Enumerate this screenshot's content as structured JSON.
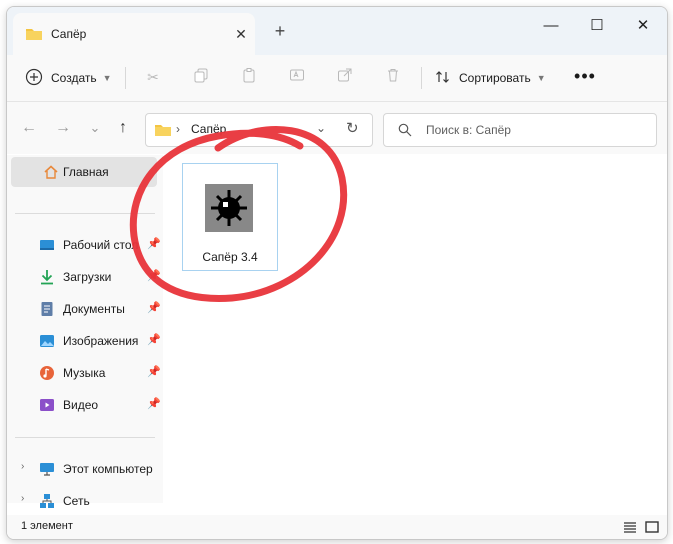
{
  "window": {
    "tab_title": "Сапёр",
    "tab_close": "✕",
    "new_tab": "+",
    "minimize": "—",
    "maximize": "☐",
    "close": "✕"
  },
  "toolbar": {
    "create_label": "Создать",
    "sort_label": "Сортировать",
    "more": "•••",
    "icons": [
      "cut-icon",
      "copy-icon",
      "paste-icon",
      "rename-icon",
      "share-icon",
      "delete-icon"
    ]
  },
  "nav": {
    "back": "←",
    "forward": "→",
    "recent": "⌄",
    "up": "↑"
  },
  "address": {
    "crumb": "Сапёр",
    "separator": "›"
  },
  "search": {
    "placeholder": "Поиск в: Сапёр"
  },
  "sidebar": {
    "home": "Главная",
    "quick_access": [
      {
        "label": "Рабочий стол",
        "icon": "desktop-icon"
      },
      {
        "label": "Загрузки",
        "icon": "download-icon"
      },
      {
        "label": "Документы",
        "icon": "documents-icon"
      },
      {
        "label": "Изображения",
        "icon": "pictures-icon"
      },
      {
        "label": "Музыка",
        "icon": "music-icon"
      },
      {
        "label": "Видео",
        "icon": "video-icon"
      }
    ],
    "this_pc": "Этот компьютер",
    "network": "Сеть"
  },
  "content": {
    "files": [
      {
        "name": "Сапёр 3.4",
        "icon": "minesweeper-icon",
        "selected": true
      }
    ]
  },
  "status": {
    "item_count": "1 элемент"
  },
  "colors": {
    "annotation": "#e8343a",
    "selection_border": "#a8d2f0",
    "folder": "#f4c542"
  }
}
